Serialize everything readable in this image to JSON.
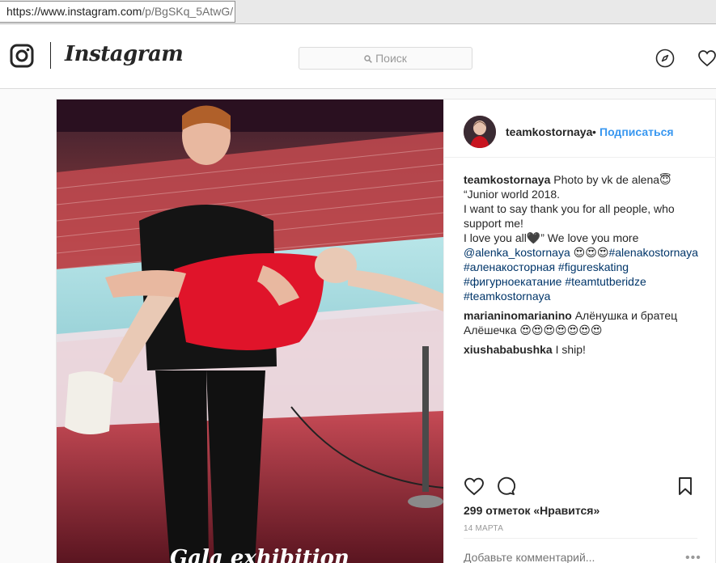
{
  "browser": {
    "url_main": "https://www.instagram.com",
    "url_path": "/p/BgSKq_5AtwG/"
  },
  "header": {
    "wordmark": "Instagram",
    "search_placeholder": "Поиск"
  },
  "post": {
    "username": "teamkostornaya",
    "dot": "•",
    "follow_label": "Подписаться",
    "caption": {
      "username": "teamkostornaya",
      "line1": "Photo by vk de alena😇",
      "line2": "“Junior world 2018.",
      "line3": "I want to say thank you for all people, who support me!",
      "line4": "I love you all🖤” We love you more",
      "mention": "@alenka_kostornaya",
      "emojis": "😍😍😍",
      "tags1": "#alenakostornaya",
      "tags2": "#аленакосторная #figureskating",
      "tags3": "#фигурноекатание #teamtutberidze",
      "tags4": "#teamkostornaya"
    },
    "comments": [
      {
        "username": "marianinomarianino",
        "text": "Алёнушка и братец Алёшечка 😍😍😍😍😍😍😍"
      },
      {
        "username": "xiushababushka",
        "text": "I ship!"
      }
    ],
    "likes": "299 отметок «Нравится»",
    "date": "14 марта",
    "add_comment_placeholder": "Добавьте комментарий...",
    "more_label": "•••",
    "photo_overlay_text": "Gala exhibition"
  },
  "colors": {
    "link_blue": "#3897f0",
    "mention_blue": "#003569",
    "dress_red": "#e0142a"
  }
}
